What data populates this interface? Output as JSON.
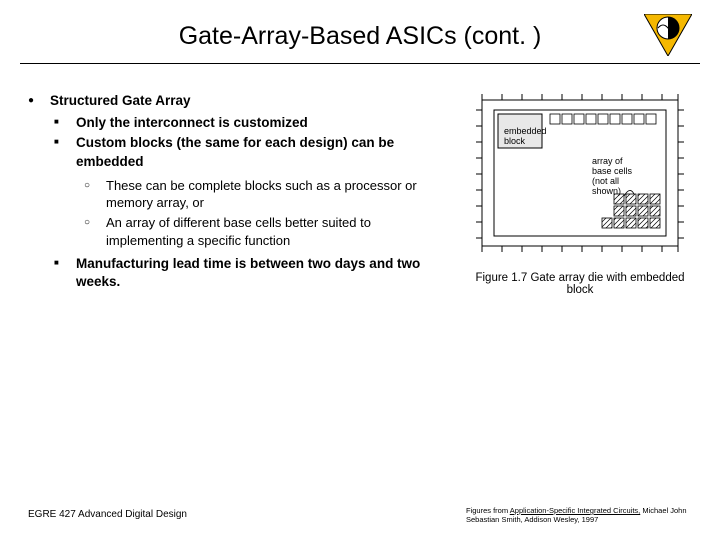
{
  "title": "Gate-Array-Based ASICs (cont. )",
  "bullets": {
    "l1": "Structured Gate Array",
    "l2a": "Only the interconnect is customized",
    "l2b": "Custom blocks (the same for each design) can be embedded",
    "l3a": "These can be complete blocks such as a processor or memory array, or",
    "l3b": "An array of different base cells better suited to implementing a specific function",
    "l2c": "Manufacturing lead time is between two days and two weeks."
  },
  "figure": {
    "caption": "Figure 1.7 Gate array die with embedded block",
    "label_embedded": "embedded block",
    "label_array": "array of base cells (not all shown)"
  },
  "footer": {
    "left": "EGRE 427 Advanced Digital Design",
    "right_pre": "Figures from ",
    "right_ul": "Application-Specific Integrated Circuits,",
    "right_post": " Michael John Sebastian Smith, Addison Wesley, 1997"
  }
}
